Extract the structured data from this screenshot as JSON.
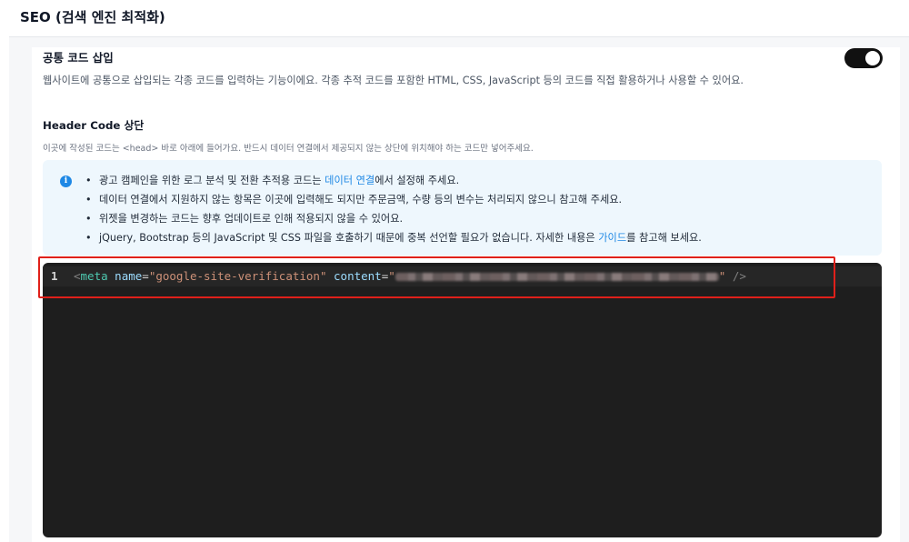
{
  "page": {
    "title": "SEO (검색 엔진 최적화)"
  },
  "section": {
    "title": "공통 코드 삽입",
    "toggle_on": true,
    "description": "웹사이트에 공통으로 삽입되는 각종 코드를 입력하는 기능이에요. 각종 추적 코드를 포함한 HTML, CSS, JavaScript 등의 코드를 직접 활용하거나 사용할 수 있어요."
  },
  "header_code": {
    "title": "Header Code 상단",
    "description": "이곳에 작성된 코드는 <head> 바로 아래에 들어가요. 반드시 데이터 연결에서 제공되지 않는 상단에 위치해야 하는 코드만 넣어주세요."
  },
  "info": {
    "icon": "info-icon",
    "items": [
      {
        "before": "광고 캠페인을 위한 로그 분석 및 전환 추적용 코드는 ",
        "link": "데이터 연결",
        "after": "에서 설정해 주세요."
      },
      {
        "text": "데이터 연결에서 지원하지 않는 항목은 이곳에 입력해도 되지만 주문금액, 수량 등의 변수는 처리되지 않으니 참고해 주세요."
      },
      {
        "text": "위젯을 변경하는 코드는 향후 업데이트로 인해 적용되지 않을 수 있어요."
      },
      {
        "before": "jQuery, Bootstrap 등의 JavaScript 및 CSS 파일을 호출하기 때문에 중복 선언할 필요가 없습니다. 자세한 내용은 ",
        "link": "가이드",
        "after": "를 참고해 보세요."
      }
    ]
  },
  "editor": {
    "line_number": "1",
    "open": "<",
    "tag": "meta",
    "attr1": "name",
    "eq": "=",
    "value1": "\"google-site-verification\"",
    "attr2": "content",
    "value2_open": "\"",
    "value2_close": "\"",
    "close": " />"
  },
  "colors": {
    "accent": "#1e88e5",
    "highlight": "#e0201a",
    "editor_bg": "#1e1e1e"
  }
}
